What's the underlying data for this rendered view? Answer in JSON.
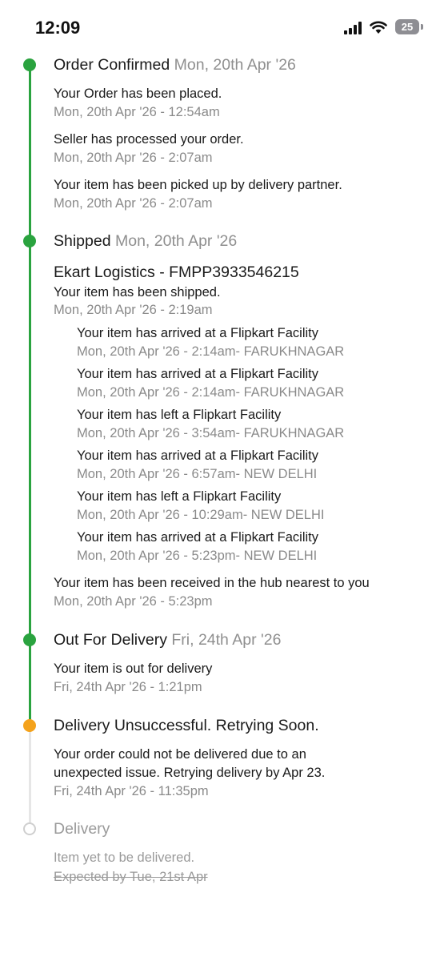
{
  "status_bar": {
    "time": "12:09",
    "battery": "25"
  },
  "timeline": {
    "order_confirmed": {
      "title": "Order Confirmed",
      "date": "Mon, 20th Apr '26",
      "events": [
        {
          "text": "Your Order has been placed.",
          "time": "Mon, 20th Apr '26 - 12:54am"
        },
        {
          "text": "Seller has processed your order.",
          "time": "Mon, 20th Apr '26 - 2:07am"
        },
        {
          "text": "Your item has been picked up by delivery partner.",
          "time": "Mon, 20th Apr '26 - 2:07am"
        }
      ]
    },
    "shipped": {
      "title": "Shipped",
      "date": "Mon, 20th Apr '26",
      "courier": "Ekart Logistics - FMPP3933546215",
      "shipped_event": {
        "text": "Your item has been shipped.",
        "time": "Mon, 20th Apr '26 - 2:19am"
      },
      "sub_events": [
        {
          "text": "Your item has arrived at a Flipkart Facility",
          "time": "Mon, 20th Apr '26 - 2:14am- FARUKHNAGAR"
        },
        {
          "text": "Your item has arrived at a Flipkart Facility",
          "time": "Mon, 20th Apr '26 - 2:14am- FARUKHNAGAR"
        },
        {
          "text": "Your item has left a Flipkart Facility",
          "time": "Mon, 20th Apr '26 - 3:54am- FARUKHNAGAR"
        },
        {
          "text": "Your item has arrived at a Flipkart Facility",
          "time": "Mon, 20th Apr '26 - 6:57am- NEW DELHI"
        },
        {
          "text": "Your item has left a Flipkart Facility",
          "time": "Mon, 20th Apr '26 - 10:29am- NEW DELHI"
        },
        {
          "text": "Your item has arrived at a Flipkart Facility",
          "time": "Mon, 20th Apr '26 - 5:23pm- NEW DELHI"
        }
      ],
      "hub_event": {
        "text": "Your item has been received in the hub nearest to you",
        "time": "Mon, 20th Apr '26 - 5:23pm"
      }
    },
    "out_for_delivery": {
      "title": "Out For Delivery",
      "date": "Fri, 24th Apr '26",
      "event": {
        "text": "Your item is out for delivery",
        "time": "Fri, 24th Apr '26 - 1:21pm"
      }
    },
    "unsuccessful": {
      "title": "Delivery Unsuccessful. Retrying Soon.",
      "line1": "Your order could not be delivered due to an",
      "line2": "unexpected issue. Retrying delivery by Apr 23.",
      "time": "Fri, 24th Apr '26 - 11:35pm"
    },
    "delivery": {
      "title": "Delivery",
      "note": "Item yet to be delivered.",
      "expected": "Expected by Tue, 21st Apr"
    }
  },
  "colors": {
    "done": "#2aa33f",
    "warning": "#f4a21b",
    "pending": "#cfcfcf"
  }
}
